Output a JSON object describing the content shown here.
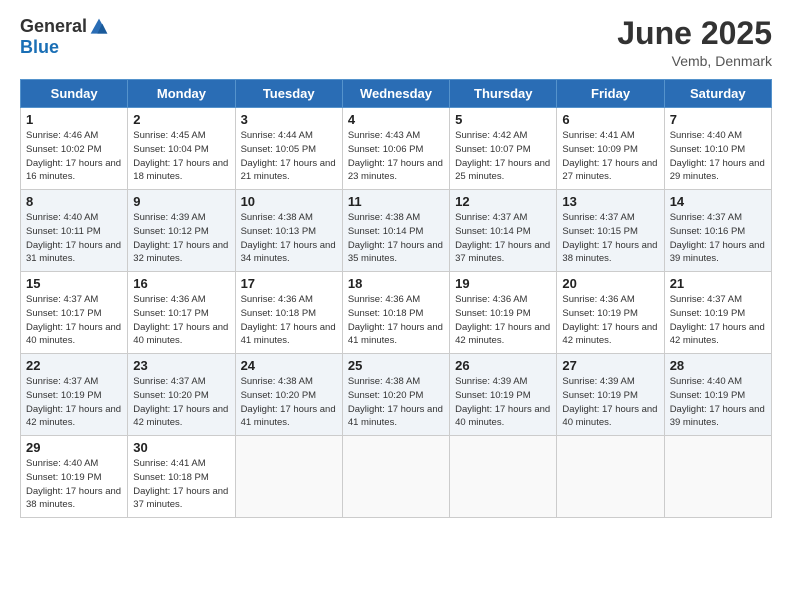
{
  "header": {
    "logo_general": "General",
    "logo_blue": "Blue",
    "month_title": "June 2025",
    "location": "Vemb, Denmark"
  },
  "days_of_week": [
    "Sunday",
    "Monday",
    "Tuesday",
    "Wednesday",
    "Thursday",
    "Friday",
    "Saturday"
  ],
  "weeks": [
    [
      {
        "day": "1",
        "sunrise": "Sunrise: 4:46 AM",
        "sunset": "Sunset: 10:02 PM",
        "daylight": "Daylight: 17 hours and 16 minutes."
      },
      {
        "day": "2",
        "sunrise": "Sunrise: 4:45 AM",
        "sunset": "Sunset: 10:04 PM",
        "daylight": "Daylight: 17 hours and 18 minutes."
      },
      {
        "day": "3",
        "sunrise": "Sunrise: 4:44 AM",
        "sunset": "Sunset: 10:05 PM",
        "daylight": "Daylight: 17 hours and 21 minutes."
      },
      {
        "day": "4",
        "sunrise": "Sunrise: 4:43 AM",
        "sunset": "Sunset: 10:06 PM",
        "daylight": "Daylight: 17 hours and 23 minutes."
      },
      {
        "day": "5",
        "sunrise": "Sunrise: 4:42 AM",
        "sunset": "Sunset: 10:07 PM",
        "daylight": "Daylight: 17 hours and 25 minutes."
      },
      {
        "day": "6",
        "sunrise": "Sunrise: 4:41 AM",
        "sunset": "Sunset: 10:09 PM",
        "daylight": "Daylight: 17 hours and 27 minutes."
      },
      {
        "day": "7",
        "sunrise": "Sunrise: 4:40 AM",
        "sunset": "Sunset: 10:10 PM",
        "daylight": "Daylight: 17 hours and 29 minutes."
      }
    ],
    [
      {
        "day": "8",
        "sunrise": "Sunrise: 4:40 AM",
        "sunset": "Sunset: 10:11 PM",
        "daylight": "Daylight: 17 hours and 31 minutes."
      },
      {
        "day": "9",
        "sunrise": "Sunrise: 4:39 AM",
        "sunset": "Sunset: 10:12 PM",
        "daylight": "Daylight: 17 hours and 32 minutes."
      },
      {
        "day": "10",
        "sunrise": "Sunrise: 4:38 AM",
        "sunset": "Sunset: 10:13 PM",
        "daylight": "Daylight: 17 hours and 34 minutes."
      },
      {
        "day": "11",
        "sunrise": "Sunrise: 4:38 AM",
        "sunset": "Sunset: 10:14 PM",
        "daylight": "Daylight: 17 hours and 35 minutes."
      },
      {
        "day": "12",
        "sunrise": "Sunrise: 4:37 AM",
        "sunset": "Sunset: 10:14 PM",
        "daylight": "Daylight: 17 hours and 37 minutes."
      },
      {
        "day": "13",
        "sunrise": "Sunrise: 4:37 AM",
        "sunset": "Sunset: 10:15 PM",
        "daylight": "Daylight: 17 hours and 38 minutes."
      },
      {
        "day": "14",
        "sunrise": "Sunrise: 4:37 AM",
        "sunset": "Sunset: 10:16 PM",
        "daylight": "Daylight: 17 hours and 39 minutes."
      }
    ],
    [
      {
        "day": "15",
        "sunrise": "Sunrise: 4:37 AM",
        "sunset": "Sunset: 10:17 PM",
        "daylight": "Daylight: 17 hours and 40 minutes."
      },
      {
        "day": "16",
        "sunrise": "Sunrise: 4:36 AM",
        "sunset": "Sunset: 10:17 PM",
        "daylight": "Daylight: 17 hours and 40 minutes."
      },
      {
        "day": "17",
        "sunrise": "Sunrise: 4:36 AM",
        "sunset": "Sunset: 10:18 PM",
        "daylight": "Daylight: 17 hours and 41 minutes."
      },
      {
        "day": "18",
        "sunrise": "Sunrise: 4:36 AM",
        "sunset": "Sunset: 10:18 PM",
        "daylight": "Daylight: 17 hours and 41 minutes."
      },
      {
        "day": "19",
        "sunrise": "Sunrise: 4:36 AM",
        "sunset": "Sunset: 10:19 PM",
        "daylight": "Daylight: 17 hours and 42 minutes."
      },
      {
        "day": "20",
        "sunrise": "Sunrise: 4:36 AM",
        "sunset": "Sunset: 10:19 PM",
        "daylight": "Daylight: 17 hours and 42 minutes."
      },
      {
        "day": "21",
        "sunrise": "Sunrise: 4:37 AM",
        "sunset": "Sunset: 10:19 PM",
        "daylight": "Daylight: 17 hours and 42 minutes."
      }
    ],
    [
      {
        "day": "22",
        "sunrise": "Sunrise: 4:37 AM",
        "sunset": "Sunset: 10:19 PM",
        "daylight": "Daylight: 17 hours and 42 minutes."
      },
      {
        "day": "23",
        "sunrise": "Sunrise: 4:37 AM",
        "sunset": "Sunset: 10:20 PM",
        "daylight": "Daylight: 17 hours and 42 minutes."
      },
      {
        "day": "24",
        "sunrise": "Sunrise: 4:38 AM",
        "sunset": "Sunset: 10:20 PM",
        "daylight": "Daylight: 17 hours and 41 minutes."
      },
      {
        "day": "25",
        "sunrise": "Sunrise: 4:38 AM",
        "sunset": "Sunset: 10:20 PM",
        "daylight": "Daylight: 17 hours and 41 minutes."
      },
      {
        "day": "26",
        "sunrise": "Sunrise: 4:39 AM",
        "sunset": "Sunset: 10:19 PM",
        "daylight": "Daylight: 17 hours and 40 minutes."
      },
      {
        "day": "27",
        "sunrise": "Sunrise: 4:39 AM",
        "sunset": "Sunset: 10:19 PM",
        "daylight": "Daylight: 17 hours and 40 minutes."
      },
      {
        "day": "28",
        "sunrise": "Sunrise: 4:40 AM",
        "sunset": "Sunset: 10:19 PM",
        "daylight": "Daylight: 17 hours and 39 minutes."
      }
    ],
    [
      {
        "day": "29",
        "sunrise": "Sunrise: 4:40 AM",
        "sunset": "Sunset: 10:19 PM",
        "daylight": "Daylight: 17 hours and 38 minutes."
      },
      {
        "day": "30",
        "sunrise": "Sunrise: 4:41 AM",
        "sunset": "Sunset: 10:18 PM",
        "daylight": "Daylight: 17 hours and 37 minutes."
      },
      null,
      null,
      null,
      null,
      null
    ]
  ]
}
